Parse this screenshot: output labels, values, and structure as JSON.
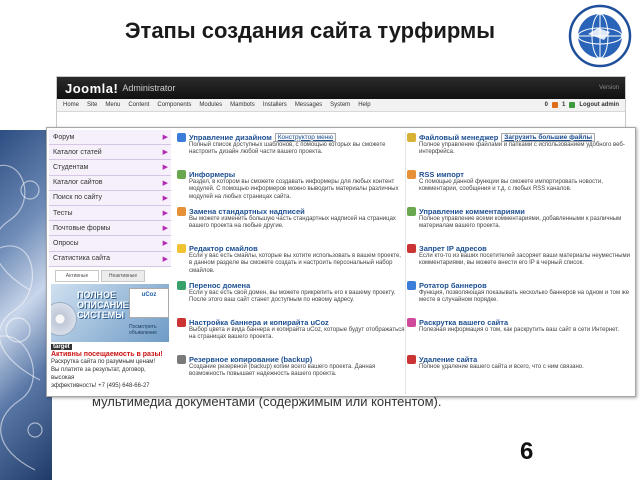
{
  "slide": {
    "title": "Этапы создания сайта турфирмы",
    "number": "6",
    "background_text": "мультимедиа документами (содержимым или контентом)."
  },
  "admin": {
    "logo": "Joomla!",
    "logo_sub": "Administrator",
    "version": "Version",
    "menu": [
      "Home",
      "Site",
      "Menu",
      "Content",
      "Components",
      "Modules",
      "Mambots",
      "Installers",
      "Messages",
      "System",
      "Help"
    ],
    "counter_orange": "0",
    "counter_green": "1",
    "logout": "Logout admin"
  },
  "sidebar": {
    "items": [
      {
        "label": "Форум"
      },
      {
        "label": "Каталог статей"
      },
      {
        "label": "Студентам"
      },
      {
        "label": "Каталог сайтов"
      },
      {
        "label": "Поиск по сайту"
      },
      {
        "label": "Тесты"
      },
      {
        "label": "Почтовые формы"
      },
      {
        "label": "Опросы"
      },
      {
        "label": "Статистика сайта"
      }
    ],
    "tabs": [
      "Активные",
      "Неактивные"
    ],
    "ad_text": "ПОЛНОЕ ОПИСАНИЕ СИСТЕМЫ",
    "ad_sticker": "uCoz",
    "ad_note": "Посмотреть объявление",
    "ad_brand": "target",
    "ad_headline": "Активны посещаемость в разы!",
    "ad_lines": [
      "Раскрутка сайта по разумным ценам!",
      "Вы платите за результат, договор, высокая",
      "эффективность! +7 (495) 648-66-27"
    ]
  },
  "services": {
    "left": [
      {
        "title": "Управление дизайном",
        "link": "Конструктор меню",
        "desc": "Полный список доступных шаблонов, с помощью которых вы сможете настроить дизайн любой части вашего проекта.",
        "color": "#3b7dd8"
      },
      {
        "title": "Информеры",
        "desc": "Раздел, в котором вы сможете создавать информеры для любых контент модулей. С помощью информеров можно выводить материалы различных модулей на любых страницах сайта.",
        "color": "#6aa84f"
      },
      {
        "title": "Замена стандартных надписей",
        "desc": "Вы можете изменить большую часть стандартных надписей на страницах вашего проекта на любые другие.",
        "color": "#e69138"
      },
      {
        "title": "Редактор смайлов",
        "desc": "Если у вас есть смайлы, которые вы хотите использовать в вашем проекте, в данном разделе вы сможете создать и настроить персональный набор смайлов.",
        "color": "#f1c232"
      },
      {
        "title": "Перенос домена",
        "desc": "Если у вас есть свой домен, вы можете прикрепить его к вашему проекту. После этого ваш сайт станет доступным по новому адресу.",
        "color": "#38a169"
      },
      {
        "title": "Настройка баннера и копирайта uCoz",
        "desc": "Выбор цвета и вида баннера и копирайта uCoz, которые будут отображаться на страницах вашего проекта.",
        "color": "#cc3333"
      },
      {
        "title": "Резервное копирование (backup)",
        "desc": "Создание резервной (backup) копии всего вашего проекта. Данная возможность повышает надежность вашего проекта.",
        "color": "#7a7a7a"
      }
    ],
    "right": [
      {
        "title": "Файловый менеджер",
        "link": "Загрузить большие файлы",
        "desc": "Полное управление файлами и папками с использованием удобного веб-интерфейса.",
        "color": "#d8b236"
      },
      {
        "title": "RSS импорт",
        "desc": "С помощью данной функции вы сможете импортировать новости, комментарии, сообщения и т.д. с любых RSS каналов.",
        "color": "#e69138"
      },
      {
        "title": "Управление комментариями",
        "desc": "Полное управление всеми комментариями, добавленными к различным материалам вашего проекта.",
        "color": "#6aa84f"
      },
      {
        "title": "Запрет IP адресов",
        "desc": "Если кто-то из ваших посетителей засоряет ваши материалы неуместными комментариями, вы можете внести его IP в черный список.",
        "color": "#cc3333"
      },
      {
        "title": "Ротатор баннеров",
        "desc": "Функция, позволяющая показывать несколько баннеров на одном и том же месте в случайном порядке.",
        "color": "#3b7dd8"
      },
      {
        "title": "Раскрутка вашего сайта",
        "desc": "Полезная информация о том, как раскрутить ваш сайт в сети Интернет.",
        "color": "#d04a9b"
      },
      {
        "title": "Удаление сайта",
        "desc": "Полное удаление вашего сайта и всего, что с ним связано.",
        "color": "#cc3333"
      }
    ]
  }
}
